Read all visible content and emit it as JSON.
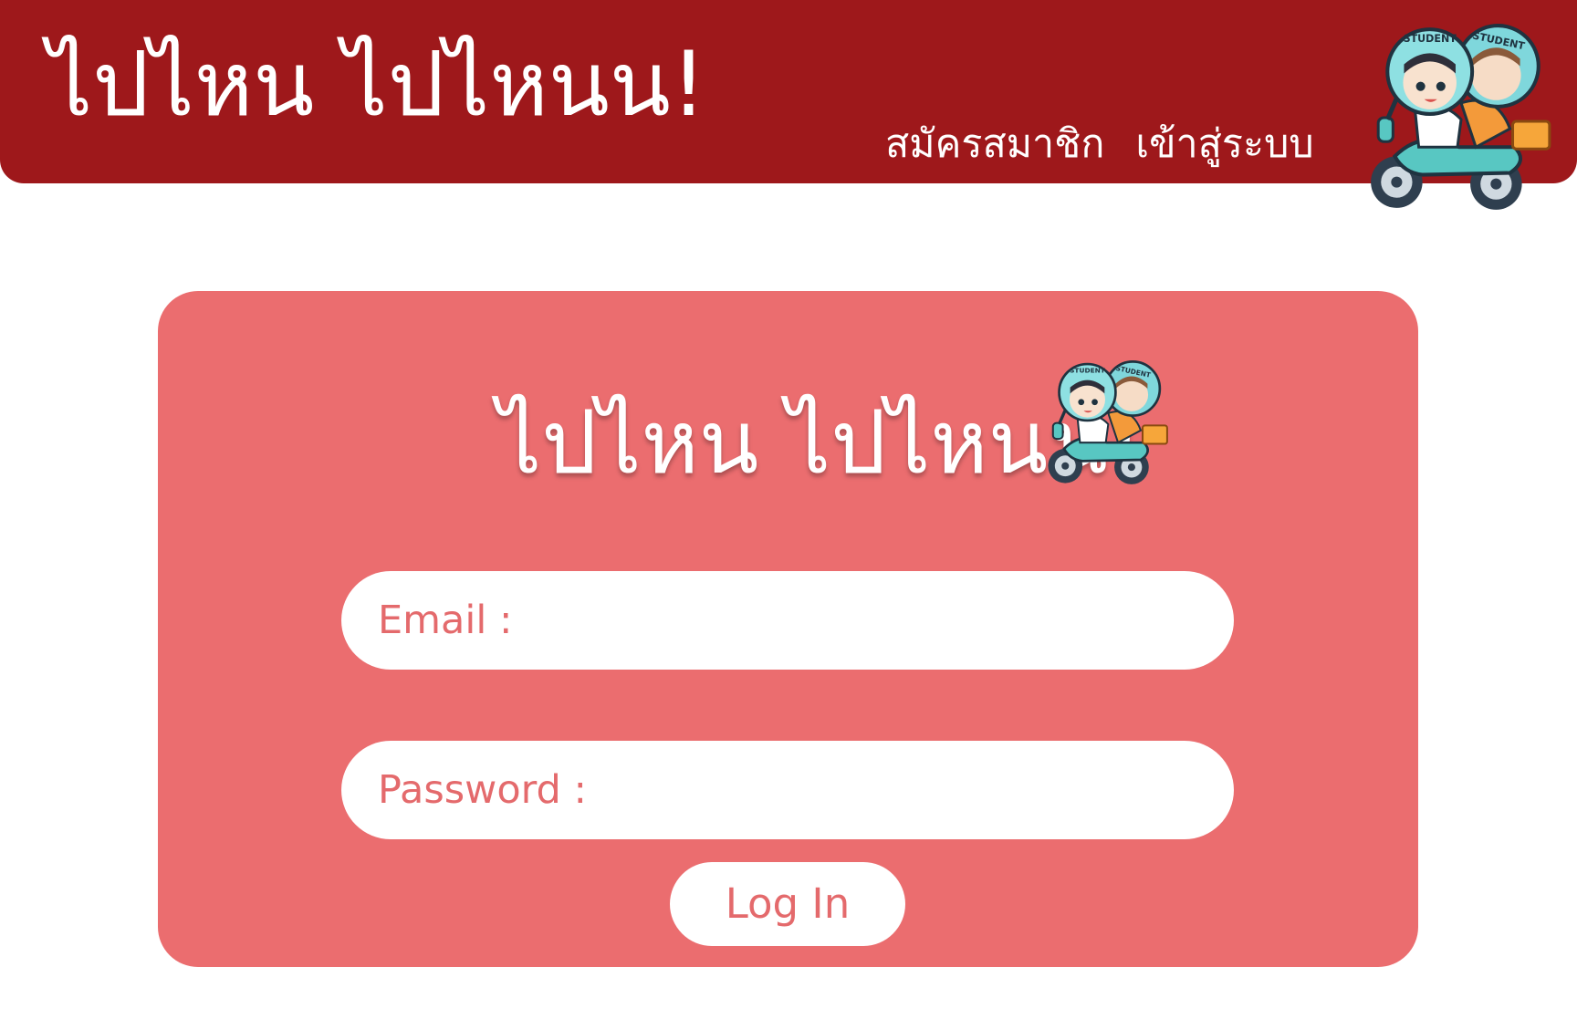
{
  "header": {
    "brand": "ไปไหน ไปไหนน!",
    "nav": [
      {
        "label": "สมัครสมาชิก"
      },
      {
        "label": "เข้าสู่ระบบ"
      }
    ],
    "logo_icon": "student-motorbike-icon",
    "logo_text": "STUDENT"
  },
  "login_card": {
    "title": "ไปไหน ไปไหนน!",
    "logo_icon": "student-motorbike-icon",
    "email": {
      "placeholder": "Email :",
      "value": ""
    },
    "password": {
      "placeholder": "Password :",
      "value": ""
    },
    "submit_label": "Log In"
  },
  "colors": {
    "header_bg": "#9e181b",
    "card_bg": "#eb6d6f",
    "field_bg": "#ffffff",
    "accent_text": "#e46a6c"
  }
}
